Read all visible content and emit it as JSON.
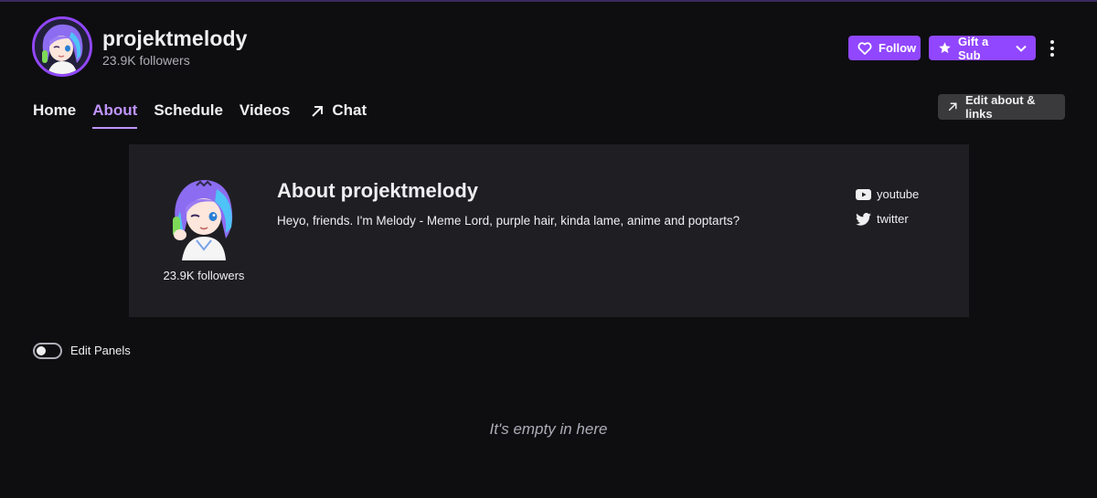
{
  "channel": {
    "name": "projektmelody",
    "followers": "23.9K followers"
  },
  "actions": {
    "follow_label": "Follow",
    "gift_label": "Gift a Sub",
    "edit_about_label": "Edit about & links"
  },
  "tabs": [
    {
      "label": "Home"
    },
    {
      "label": "About"
    },
    {
      "label": "Schedule"
    },
    {
      "label": "Videos"
    },
    {
      "label": "Chat"
    }
  ],
  "about": {
    "title": "About projektmelody",
    "bio": "Heyo, friends. I'm Melody - Meme Lord, purple hair, kinda lame, anime and poptarts?",
    "followers": "23.9K followers",
    "socials": [
      {
        "label": "youtube",
        "icon": "youtube-icon"
      },
      {
        "label": "twitter",
        "icon": "twitter-icon"
      }
    ]
  },
  "panels": {
    "toggle_label": "Edit Panels",
    "empty_text": "It's empty in here"
  },
  "colors": {
    "background": "#0e0e10",
    "card": "#1f1f23",
    "accent": "#9147ff",
    "accent_light": "#bf94ff"
  }
}
